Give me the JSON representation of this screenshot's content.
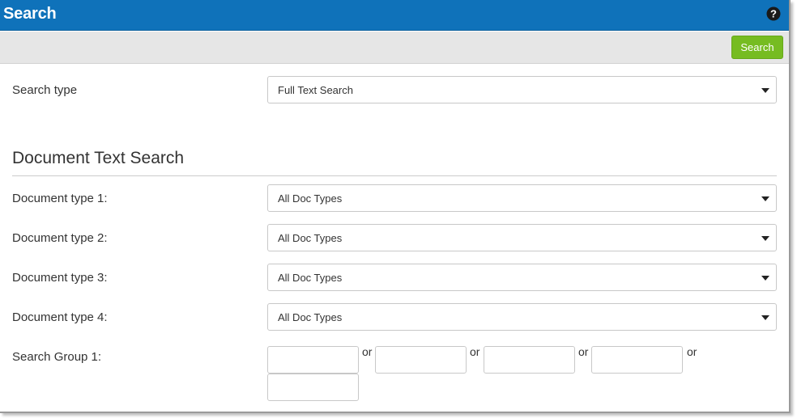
{
  "header": {
    "title": "Search",
    "help_icon": "help-icon"
  },
  "toolbar": {
    "search_label": "Search"
  },
  "search_type": {
    "label": "Search type",
    "value": "Full Text Search"
  },
  "document_text_search": {
    "title": "Document Text Search",
    "doc_types": [
      {
        "label": "Document type 1:",
        "value": "All Doc Types"
      },
      {
        "label": "Document type 2:",
        "value": "All Doc Types"
      },
      {
        "label": "Document type 3:",
        "value": "All Doc Types"
      },
      {
        "label": "Document type 4:",
        "value": "All Doc Types"
      }
    ],
    "search_group": {
      "label": "Search Group 1:",
      "inputs": [
        "",
        "",
        "",
        "",
        ""
      ],
      "separator": "or"
    }
  },
  "colors": {
    "header_bg": "#0f72ba",
    "search_button": "#76bc21",
    "toolbar_bg": "#e6e6e6"
  }
}
